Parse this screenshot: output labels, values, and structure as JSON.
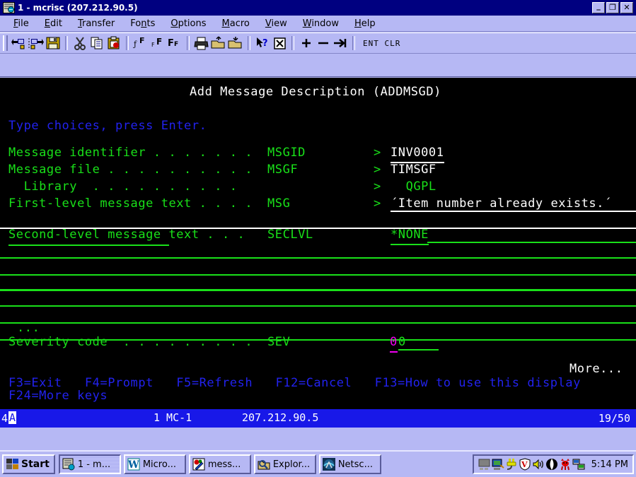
{
  "window": {
    "title": "1 - mcrisc (207.212.90.5)",
    "icon": "terminal-session-icon",
    "buttons": {
      "minimize": "_",
      "restore": "❐",
      "close": "✕"
    }
  },
  "menubar": {
    "items": [
      {
        "label": "File",
        "accel": "F"
      },
      {
        "label": "Edit",
        "accel": "E"
      },
      {
        "label": "Transfer",
        "accel": "T"
      },
      {
        "label": "Fonts",
        "accel": "n"
      },
      {
        "label": "Options",
        "accel": "O"
      },
      {
        "label": "Macro",
        "accel": "M"
      },
      {
        "label": "View",
        "accel": "V"
      },
      {
        "label": "Window",
        "accel": "W"
      },
      {
        "label": "Help",
        "accel": "H"
      }
    ]
  },
  "toolbar": {
    "buttons": [
      {
        "name": "send-file-icon"
      },
      {
        "name": "receive-file-icon"
      },
      {
        "name": "save-icon"
      },
      {
        "name": "cut-icon"
      },
      {
        "name": "copy-icon"
      },
      {
        "name": "paste-icon"
      },
      {
        "name": "font-small-icon"
      },
      {
        "name": "font-medium-icon"
      },
      {
        "name": "font-large-icon"
      },
      {
        "name": "print-icon"
      },
      {
        "name": "print-screen-icon"
      },
      {
        "name": "open-folder-up-icon"
      },
      {
        "name": "open-folder-down-icon"
      },
      {
        "name": "context-help-icon"
      },
      {
        "name": "stop-icon"
      },
      {
        "name": "plus-icon"
      },
      {
        "name": "minus-icon"
      },
      {
        "name": "field-exit-icon"
      }
    ],
    "key_labels": "ENT CLR"
  },
  "terminal": {
    "screen_title": "Add Message Description (ADDMSGD)",
    "instruction": "Type choices, press Enter.",
    "fields": [
      {
        "label": "Message identifier . . . . . . .",
        "keyword": "MSGID",
        "prompt": ">",
        "value": "INV0001",
        "value_color": "white",
        "underlined": true
      },
      {
        "label": "Message file . . . . . . . . . .",
        "keyword": "MSGF",
        "prompt": ">",
        "value": "TIMSGF",
        "value_color": "white",
        "underlined": false
      },
      {
        "label": "  Library  . . . . . . . . . .",
        "keyword": "",
        "prompt": ">",
        "value": "  QGPL",
        "value_color": "green",
        "underlined": false
      },
      {
        "label": "First-level message text . . . .",
        "keyword": "MSG",
        "prompt": ">",
        "value": "´Item number already exists.´",
        "value_color": "white",
        "underlined": true
      }
    ],
    "seclvl": {
      "label": "Second-level message text . . .",
      "keyword": "SECLVL",
      "value": "*NONE",
      "value_color": "green",
      "blank_lines": 6
    },
    "more_indicator": "...",
    "severity": {
      "label": "Severity code  . . . . . . . . .",
      "keyword": "SEV",
      "value_cursor": "0",
      "value_rest": "0"
    },
    "more_text": "More...",
    "function_keys_line1": "F3=Exit   F4=Prompt   F5=Refresh   F12=Cancel   F13=How to use this display",
    "function_keys_line2": "F24=More keys",
    "colors": {
      "green": "#19e019",
      "white": "#ffffff",
      "blue": "#2222ee",
      "magenta": "#f000f0",
      "background": "#000000"
    }
  },
  "status_bar": {
    "system_indicator": "4",
    "keyboard_indicator": "A",
    "session": "1 MC-1",
    "host": "207.212.90.5",
    "cursor_position": "19/50"
  },
  "taskbar": {
    "start_label": "Start",
    "tasks": [
      {
        "label": "1 - m...",
        "icon": "terminal-session-icon",
        "active": true
      },
      {
        "label": "Micro...",
        "icon": "word-icon",
        "active": false
      },
      {
        "label": "mess...",
        "icon": "paint-icon",
        "active": false
      },
      {
        "label": "Explor...",
        "icon": "explorer-icon",
        "active": false
      },
      {
        "label": "Netsc...",
        "icon": "netscape-icon",
        "active": false
      }
    ],
    "tray_icons": [
      "monitor-icon",
      "network-monitor-icon",
      "power-plug-icon",
      "antivirus-shield-icon",
      "volume-icon",
      "moon-icon",
      "devil-icon",
      "network-connection-icon"
    ],
    "clock": "5:14 PM"
  }
}
